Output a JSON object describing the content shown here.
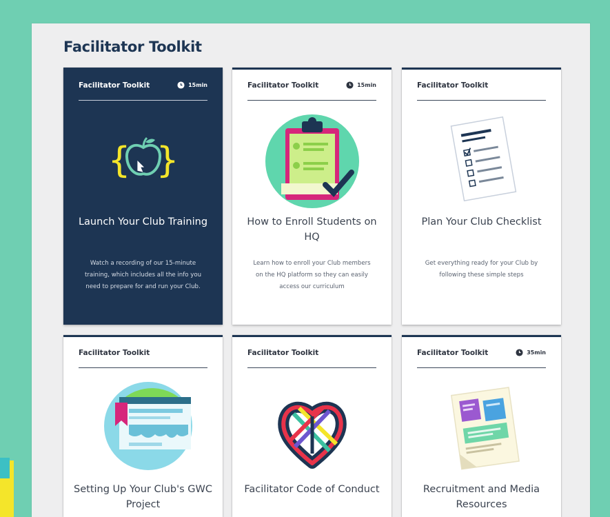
{
  "page": {
    "title": "Facilitator Toolkit"
  },
  "cards": [
    {
      "kicker": "Facilitator Toolkit",
      "duration": "15min",
      "icon": "apple-braces-icon",
      "title": "Launch Your Club Training",
      "description": "Watch a recording of our 15-minute training, which includes all the info you need to prepare for and run your Club."
    },
    {
      "kicker": "Facilitator Toolkit",
      "duration": "15min",
      "icon": "clipboard-check-icon",
      "title": "How to Enroll Students on HQ",
      "description": "Learn how to enroll your Club members on the HQ platform so they can easily access our curriculum"
    },
    {
      "kicker": "Facilitator Toolkit",
      "icon": "checklist-document-icon",
      "title": "Plan Your Club Checklist",
      "description": "Get everything ready for your Club by following these simple steps"
    },
    {
      "kicker": "Facilitator Toolkit",
      "icon": "bookmarked-browser-icon",
      "title": "Setting Up Your Club's GWC Project"
    },
    {
      "kicker": "Facilitator Toolkit",
      "icon": "woven-heart-icon",
      "title": "Facilitator Code of Conduct"
    },
    {
      "kicker": "Facilitator Toolkit",
      "duration": "35min",
      "icon": "media-flyer-icon",
      "title": "Recruitment and Media Resources"
    }
  ],
  "colors": {
    "background": "#6fcfb2",
    "panel": "#eeeeef",
    "navy": "#1d3553",
    "yellow": "#f4e52a"
  }
}
